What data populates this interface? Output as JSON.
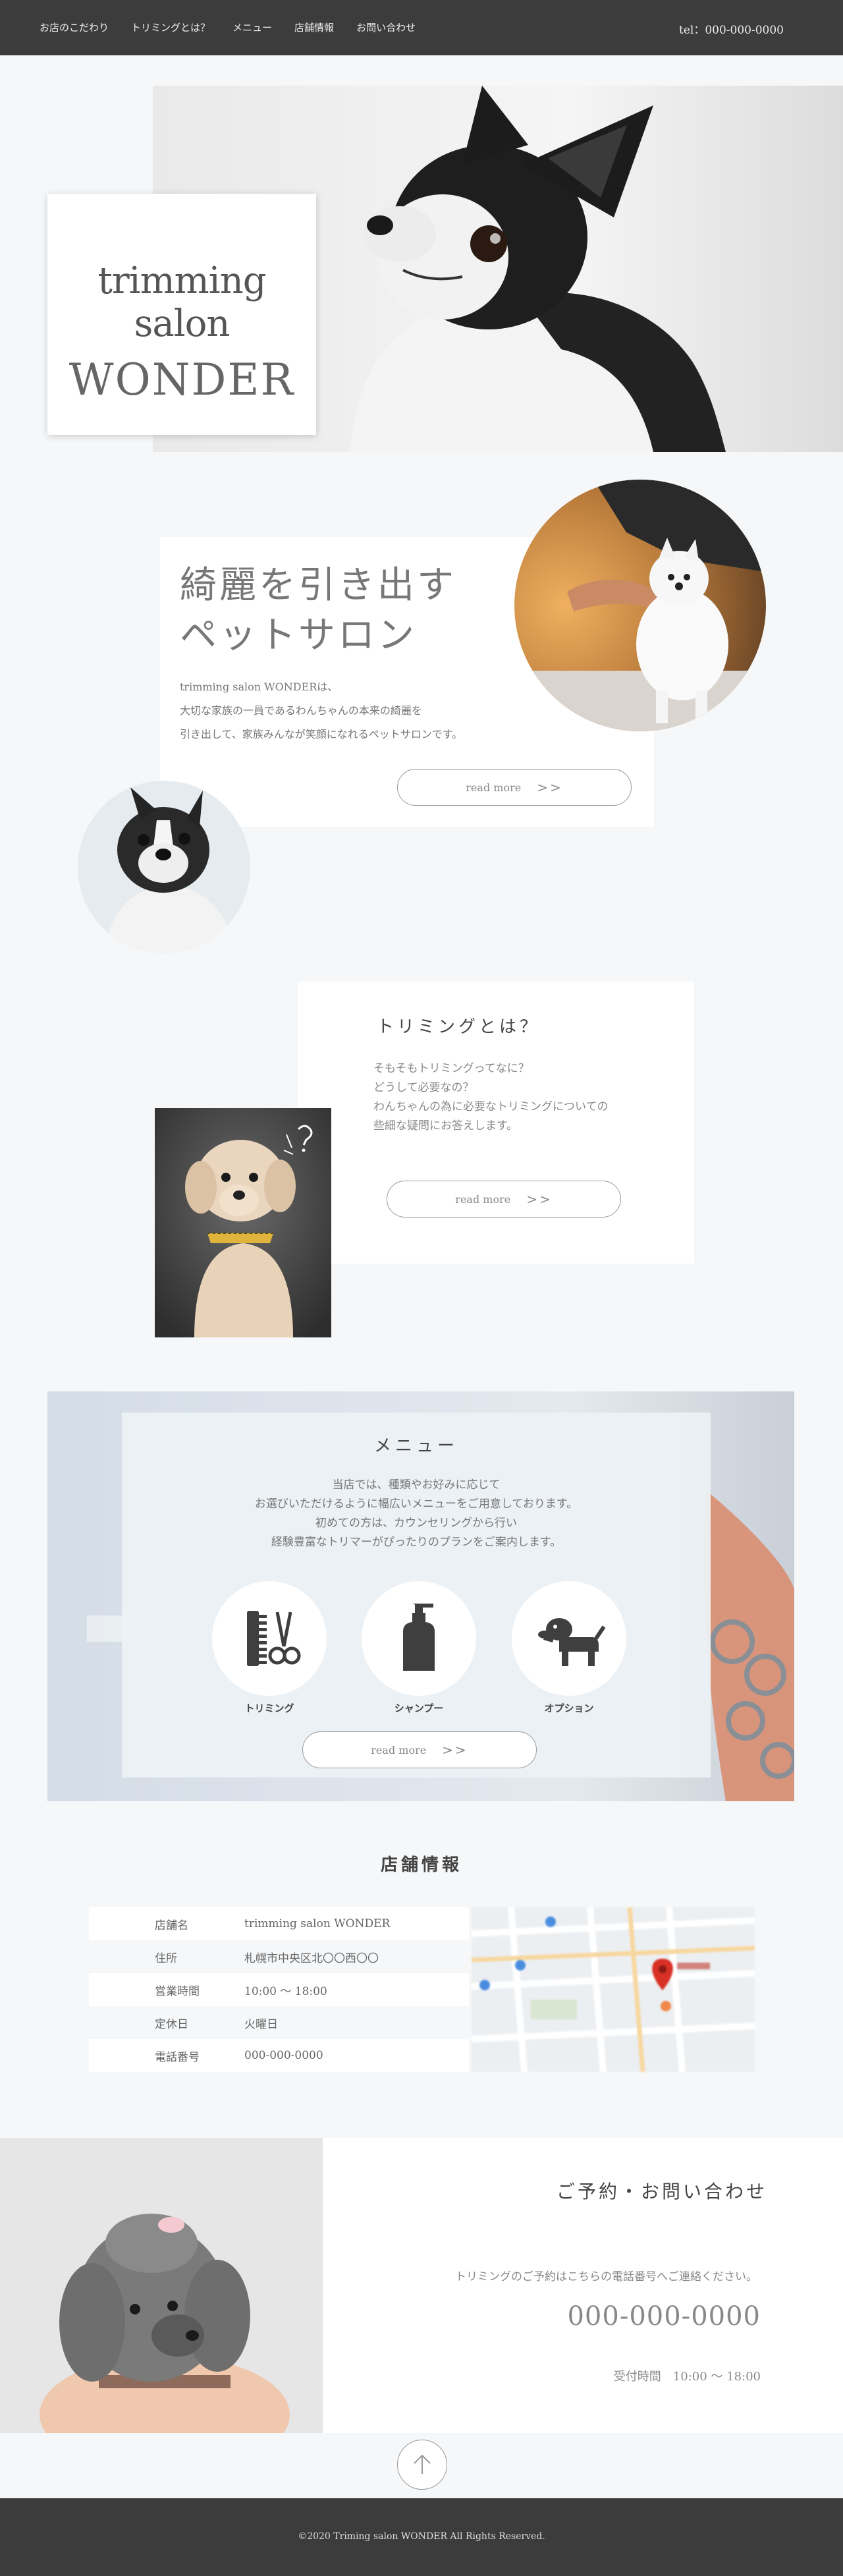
{
  "header": {
    "nav": [
      "お店のこだわり",
      "トリミングとは？",
      "メニュー",
      "店舗情報",
      "お問い合わせ"
    ],
    "tel": "tel：000-000-0000"
  },
  "hero": {
    "title_line1": "trimming salon",
    "title_line2": "WONDER"
  },
  "about": {
    "heading_line1": "綺麗を引き出す",
    "heading_line2": "ペットサロン",
    "body": [
      "trimming salon WONDERは、",
      "大切な家族の一員であるわんちゃんの本来の綺麗を",
      "引き出して、家族みんなが笑顔になれるペットサロンです。"
    ],
    "button_label": "read more",
    "button_arrow": ">>"
  },
  "trimming": {
    "title": "トリミングとは？",
    "body": [
      "そもそもトリミングってなに？",
      "どうして必要なの？",
      "わんちゃんの為に必要なトリミングについての",
      "些細な疑問にお答えします。"
    ],
    "button_label": "read more",
    "button_arrow": ">>"
  },
  "menu": {
    "title": "メニュー",
    "body": [
      "当店では、種類やお好みに応じて",
      "お選びいただけるように幅広いメニューをご用意しております。",
      "初めての方は、カウンセリングから行い",
      "経験豊富なトリマーがぴったりのプランをご案内します。"
    ],
    "items": [
      {
        "label": "トリミング",
        "icon": "comb-scissors-icon"
      },
      {
        "label": "シャンプー",
        "icon": "shampoo-bottle-icon"
      },
      {
        "label": "オプション",
        "icon": "dog-icon"
      }
    ],
    "button_label": "read more",
    "button_arrow": ">>"
  },
  "shop": {
    "title": "店舗情報",
    "rows": [
      {
        "key": "店舗名",
        "value": "trimming salon WONDER"
      },
      {
        "key": "住所",
        "value": "札幌市中央区北〇〇西〇〇"
      },
      {
        "key": "営業時間",
        "value": "10:00 〜 18:00"
      },
      {
        "key": "定休日",
        "value": "火曜日"
      },
      {
        "key": "電話番号",
        "value": "000-000-0000"
      }
    ]
  },
  "contact": {
    "title": "ご予約・お問い合わせ",
    "note": "トリミングのご予約はこちらの電話番号へご連絡ください。",
    "phone": "000-000-0000",
    "hours": "受付時間　10:00 〜 18:00"
  },
  "footer": {
    "copyright": "©2020 Triming salon WONDER All Rights Reserved."
  },
  "colors": {
    "header_bg": "#3c3c3c",
    "page_bg": "#f5f7f9",
    "icon_dark": "#3f3f3f"
  }
}
